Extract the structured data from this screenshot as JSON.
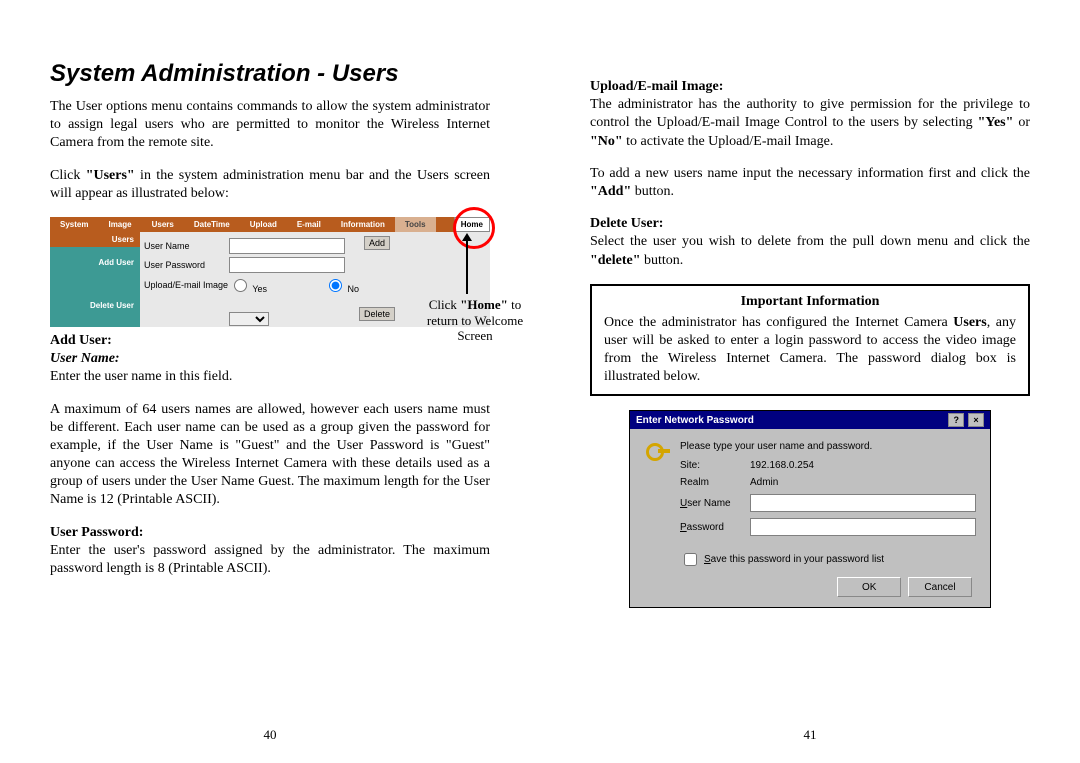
{
  "left": {
    "heading": "System Administration - Users",
    "intro1": "The User options menu contains commands to allow the system administrator to assign legal users who are permitted to monitor the Wireless Internet Camera from the remote site.",
    "intro2a": "Click ",
    "intro2b": "\"Users\"",
    "intro2c": " in the system administration menu bar and the Users screen will appear as illustrated below:",
    "menu": {
      "system": "System",
      "image": "Image",
      "users": "Users",
      "datetime": "DateTime",
      "upload": "Upload",
      "email": "E-mail",
      "information": "Information",
      "tools": "Tools",
      "home": "Home"
    },
    "side": {
      "users": "Users",
      "add": "Add User",
      "delete": "Delete User"
    },
    "form": {
      "username": "User Name",
      "password": "User Password",
      "uploadimg": "Upload/E-mail Image",
      "yes": "Yes",
      "no": "No",
      "add": "Add",
      "delete": "Delete"
    },
    "home_note_a": "Click ",
    "home_note_b": "\"Home\"",
    "home_note_c": " to return to Welcome Screen",
    "adduser_h": "Add User:",
    "username_h": "User Name:",
    "username_txt": "Enter the user name in this field.",
    "maxusers": "A maximum of 64 users names are allowed, however each users name must be different.  Each user name can be used as a group given the password for example, if the User Name is \"Guest\" and the User Password is \"Guest\" anyone can access the Wireless Internet Camera with these details used as a group of users under the User Name Guest.  The maximum length for the User Name is 12 (Printable ASCII).",
    "password_h": "User Password:",
    "password_txt": "Enter the user's password assigned by the administrator.  The maximum password length is 8 (Printable ASCII).",
    "pagenum": "40"
  },
  "right": {
    "upload_h": "Upload/E-mail Image:",
    "upload_txt_a": "The administrator has the authority to give permission for the privilege to control the Upload/E-mail Image Control to the users by selecting ",
    "upload_txt_b": "\"Yes\"",
    "upload_txt_c": " or ",
    "upload_txt_d": "\"No\"",
    "upload_txt_e": " to activate the Upload/E-mail Image.",
    "addnew_a": "To add a new users name input the necessary information first and click the ",
    "addnew_b": "\"Add\"",
    "addnew_c": " button.",
    "delete_h": "Delete User:",
    "delete_txt_a": "Select the user you wish to delete from the pull down menu and click the ",
    "delete_txt_b": "\"delete\"",
    "delete_txt_c": " button.",
    "important_title": "Important Information",
    "important_txt_a": "Once the administrator has configured the Internet Camera ",
    "important_txt_b": "Users",
    "important_txt_c": ", any user will be asked to enter a login password to access the video image from the Wireless Internet Camera. The password dialog box is illustrated below.",
    "dialog": {
      "title": "Enter Network Password",
      "help": "?",
      "close": "×",
      "prompt": "Please type your user name and password.",
      "site_l": "Site:",
      "site_v": "192.168.0.254",
      "realm_l": "Realm",
      "realm_v": "Admin",
      "user_l_a": "U",
      "user_l_b": "ser Name",
      "pass_l_a": "P",
      "pass_l_b": "assword",
      "save_a": "S",
      "save_b": "ave this password in your password list",
      "ok": "OK",
      "cancel": "Cancel"
    },
    "pagenum": "41"
  }
}
